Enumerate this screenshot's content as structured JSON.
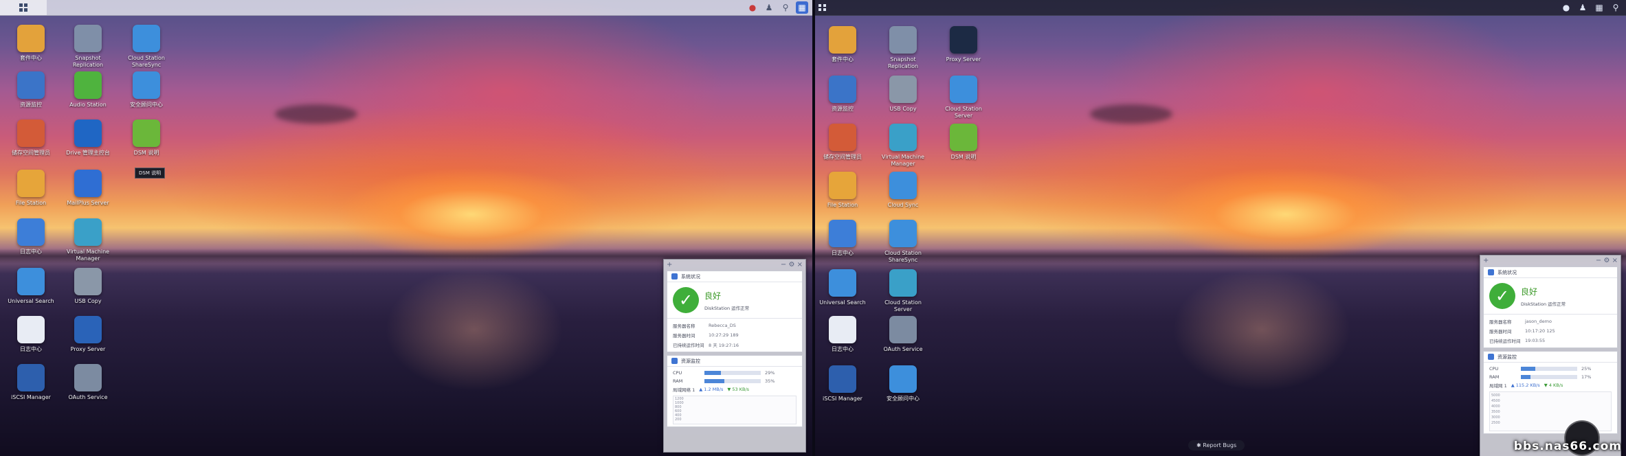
{
  "left_desktop": {
    "tooltip": "DSM 说明",
    "icons": [
      {
        "name": "package-center-icon",
        "label": "套件中心",
        "color": "#e3a23b"
      },
      {
        "name": "snapshot-replication-icon",
        "label": "Snapshot Replication",
        "color": "#7f8fa8"
      },
      {
        "name": "cloud-station-sharesync-icon",
        "label": "Cloud Station ShareSync",
        "color": "#3d8fdc"
      },
      {
        "name": "resource-monitor-icon",
        "label": "资源监控",
        "color": "#3b74c8"
      },
      {
        "name": "audio-station-icon",
        "label": "Audio Station",
        "color": "#4fb33e"
      },
      {
        "name": "security-advisor-icon",
        "label": "安全顾问中心",
        "color": "#3d8fdc"
      },
      {
        "name": "storage-manager-icon",
        "label": "储存空间管理员",
        "color": "#d35b38"
      },
      {
        "name": "drive-admin-console-icon",
        "label": "Drive 管理主控台",
        "color": "#1f66c4"
      },
      {
        "name": "dsm-help-icon",
        "label": "DSM 说明",
        "color": "#6bb73a"
      },
      {
        "name": "file-station-icon",
        "label": "File Station",
        "color": "#e6a53a"
      },
      {
        "name": "mailplus-server-icon",
        "label": "MailPlus Server",
        "color": "#2f6ed3"
      },
      {
        "name": "log-center-icon",
        "label": "日志中心",
        "color": "#3d7ed8"
      },
      {
        "name": "virtual-machine-manager-icon",
        "label": "Virtual Machine Manager",
        "color": "#3aa0c8"
      },
      {
        "name": "universal-search-icon",
        "label": "Universal Search",
        "color": "#3d8fdc"
      },
      {
        "name": "usb-copy-icon",
        "label": "USB Copy",
        "color": "#8a97a8"
      },
      {
        "name": "log-center-2-icon",
        "label": "日志中心",
        "color": "#e8ecf4"
      },
      {
        "name": "proxy-server-icon",
        "label": "Proxy Server",
        "color": "#2a63b8"
      },
      {
        "name": "iscsi-manager-icon",
        "label": "iSCSI Manager",
        "color": "#2d5fad"
      },
      {
        "name": "oauth-service-icon",
        "label": "OAuth Service",
        "color": "#7c8ba1"
      }
    ],
    "widget": {
      "health_header": "系统状况",
      "health_status": "良好",
      "health_detail": "DiskStation 运作正常",
      "rows": [
        {
          "k": "服务器名称",
          "v": "Rebecca_DS"
        },
        {
          "k": "服务器时间",
          "v": "10:27:29 189"
        },
        {
          "k": "已持续运作时间",
          "v": "8 天 19:27:16"
        }
      ],
      "resource_header": "资源监控",
      "cpu_label": "CPU",
      "cpu_pct": "29%",
      "cpu_value": 29,
      "ram_label": "RAM",
      "ram_pct": "35%",
      "ram_value": 35,
      "net_label": "局域网络 1",
      "net_up": "1.2 MB/s",
      "net_down": "53 KB/s",
      "chart_ticks": [
        "1200",
        "1000",
        "800",
        "600",
        "400",
        "200"
      ]
    }
  },
  "right_desktop": {
    "cursor_visible": true,
    "icons": [
      {
        "name": "package-center-icon",
        "label": "套件中心",
        "color": "#e3a23b"
      },
      {
        "name": "snapshot-replication-icon",
        "label": "Snapshot Replication",
        "color": "#7f8fa8"
      },
      {
        "name": "proxy-server-icon",
        "label": "Proxy Server",
        "color": "#1c2a44"
      },
      {
        "name": "resource-monitor-icon",
        "label": "资源监控",
        "color": "#3b74c8"
      },
      {
        "name": "usb-copy-icon",
        "label": "USB Copy",
        "color": "#8a97a8"
      },
      {
        "name": "cloud-station-server-icon",
        "label": "Cloud Station Server",
        "color": "#3d8fdc"
      },
      {
        "name": "storage-manager-icon",
        "label": "储存空间管理员",
        "color": "#d35b38"
      },
      {
        "name": "virtual-machine-manager-icon",
        "label": "Virtual Machine Manager",
        "color": "#3aa0c8"
      },
      {
        "name": "dsm-help-icon",
        "label": "DSM 说明",
        "color": "#6bb73a"
      },
      {
        "name": "file-station-icon",
        "label": "File Station",
        "color": "#e6a53a"
      },
      {
        "name": "cloud-sync-icon",
        "label": "Cloud Sync",
        "color": "#3d8fdc"
      },
      {
        "name": "log-center-icon",
        "label": "日志中心",
        "color": "#3d7ed8"
      },
      {
        "name": "cloud-station-sharesync-icon",
        "label": "Cloud Station ShareSync",
        "color": "#3d8fdc"
      },
      {
        "name": "universal-search-icon",
        "label": "Universal Search",
        "color": "#3d8fdc"
      },
      {
        "name": "cloud-station-server-2-icon",
        "label": "Cloud Station Server",
        "color": "#3aa0c8"
      },
      {
        "name": "log-center-2-icon",
        "label": "日志中心",
        "color": "#e8ecf4"
      },
      {
        "name": "oauth-service-icon",
        "label": "OAuth Service",
        "color": "#7c8ba1"
      },
      {
        "name": "iscsi-manager-icon",
        "label": "iSCSI Manager",
        "color": "#2d5fad"
      },
      {
        "name": "security-advisor-icon",
        "label": "安全顾问中心",
        "color": "#3d8fdc"
      }
    ],
    "widget": {
      "health_header": "系统状况",
      "health_status": "良好",
      "health_detail": "DiskStation 运作正常",
      "rows": [
        {
          "k": "服务器名称",
          "v": "jason_demo"
        },
        {
          "k": "服务器时间",
          "v": "10:17:20 125"
        },
        {
          "k": "已持续运作时间",
          "v": "19:03:55"
        }
      ],
      "resource_header": "资源监控",
      "cpu_label": "CPU",
      "cpu_pct": "25%",
      "cpu_value": 25,
      "ram_label": "RAM",
      "ram_pct": "17%",
      "ram_value": 17,
      "net_label": "局域网 1",
      "net_up": "115.2 KB/s",
      "net_down": "4 KB/s",
      "chart_ticks": [
        "5000",
        "4500",
        "4000",
        "3500",
        "3000",
        "2500"
      ]
    },
    "report_bugs": "Report Bugs"
  },
  "watermark": "bbs.nas66.com",
  "tray_icons": [
    "notification-icon",
    "user-icon",
    "search-icon",
    "widgets-icon"
  ]
}
